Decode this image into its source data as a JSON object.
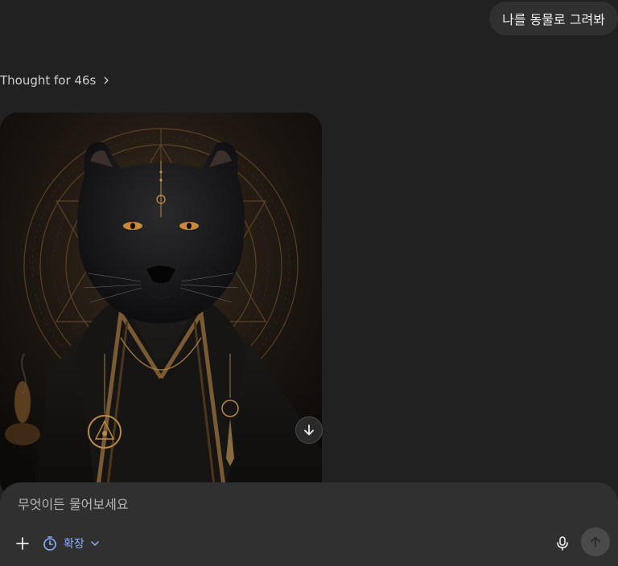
{
  "conversation": {
    "user_message": "나를 동물로 그려봐",
    "thought_label": "Thought for 46s"
  },
  "image": {
    "subject": "black panther in dark ornate robe",
    "icon": "scroll-down-arrow-icon"
  },
  "composer": {
    "placeholder": "무엇이든 물어보세요",
    "tool_label": "확장",
    "plus_icon": "plus-icon",
    "tool_icon": "timer-icon",
    "mic_icon": "microphone-icon",
    "send_icon": "arrow-up-icon"
  },
  "colors": {
    "background": "#212121",
    "bubble": "#303030",
    "accent": "#89b4fa",
    "gold": "#b8894a"
  }
}
